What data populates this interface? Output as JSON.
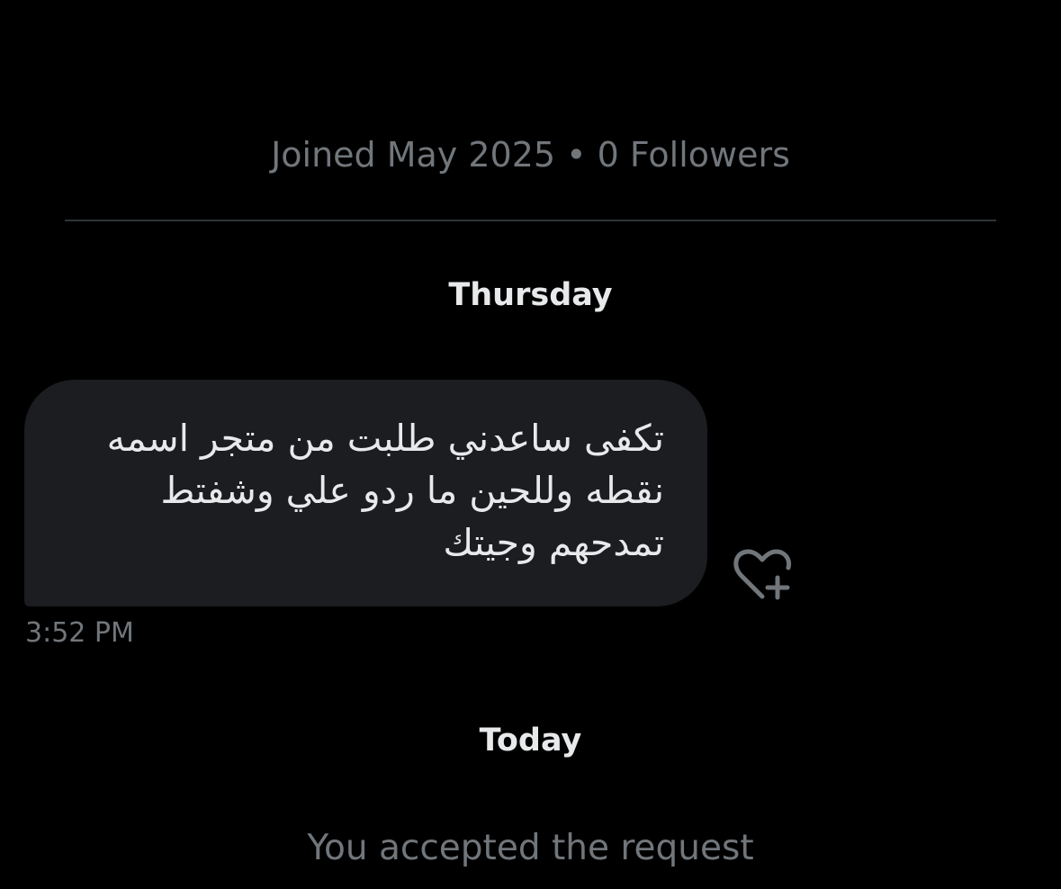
{
  "profile": {
    "meta": "Joined May 2025 • 0 Followers"
  },
  "conversation": {
    "date_separator_1": "Thursday",
    "message": {
      "text": "تكفى ساعدني طلبت من متجر اسمه\nنقطه وللحين ما ردو علي وشفتط\nتمدحهم وجيتك",
      "time": "3:52 PM",
      "reaction_icon": "heart-plus-icon"
    },
    "date_separator_2": "Today",
    "system_message": "You accepted the request"
  },
  "colors": {
    "background": "#000000",
    "bubble": "#1b1d20",
    "primary_text": "#e7e9ea",
    "secondary_text": "#71767b",
    "divider": "#2f3336"
  }
}
